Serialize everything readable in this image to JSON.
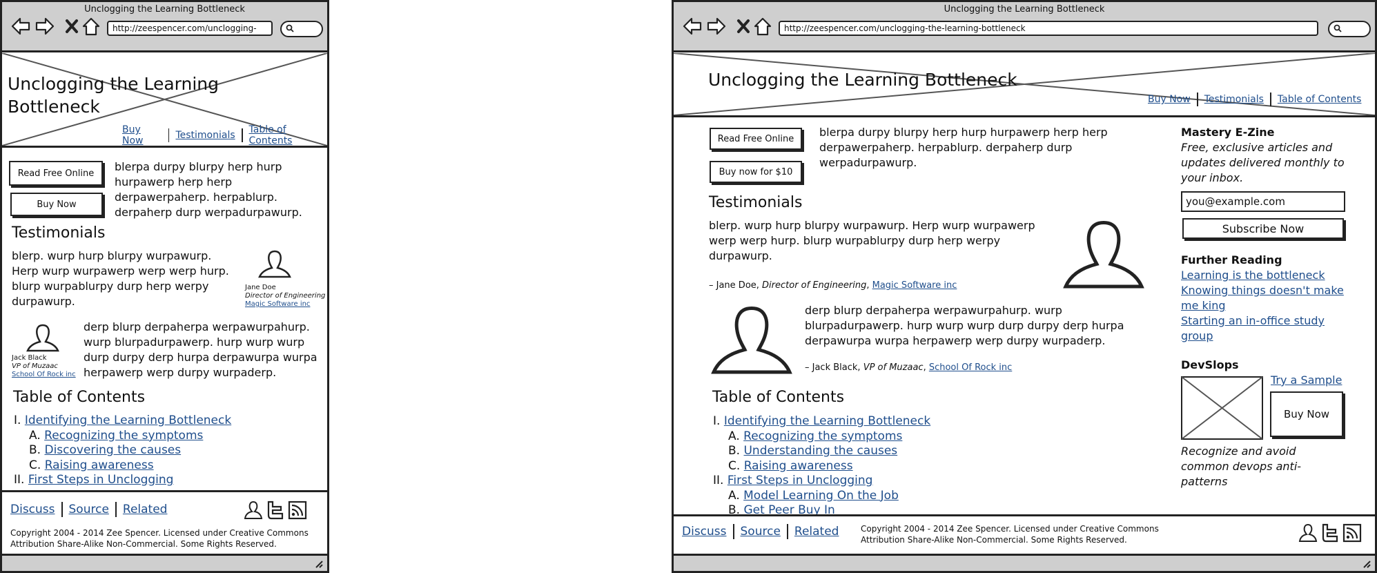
{
  "window_title": "Unclogging the Learning Bottleneck",
  "mobile": {
    "url": "http://zeespencer.com/unclogging-"
  },
  "desktop": {
    "url": "http://zeespencer.com/unclogging-the-learning-bottleneck"
  },
  "site": {
    "title": "Unclogging the Learning Bottleneck",
    "nav": [
      "Buy Now",
      "Testimonials",
      "Table of Contents"
    ]
  },
  "buttons": {
    "read_free": "Read Free Online",
    "buy_now": "Buy Now",
    "buy_now_price": "Buy now for $10"
  },
  "intro": "blerpa durpy blurpy herp hurp hurpawerp herp herp derpawerpaherp. herpablurp. derpaherp durp werpadurpawurp.",
  "testimonials": {
    "heading": "Testimonials",
    "items": [
      {
        "text": "blerp. wurp hurp blurpy wurpawurp. Herp wurp wurpawerp werp werp hurp. blurp wurpablurpy durp herp werpy durpawurp.",
        "name": "Jane Doe",
        "role": "Director of Engineering",
        "company": "Magic Software inc"
      },
      {
        "text": "derp blurp derpaherpa werpawurpahurp. wurp blurpadurpawerp. hurp wurp wurp durp durpy derp hurpa derpawurpa wurpa herpawerp werp durpy wurpaderp.",
        "name": "Jack Black",
        "role": "VP of Muzaac",
        "company": "School Of Rock inc"
      }
    ],
    "desktop_attr": [
      "– Jane Doe, ",
      "Director of Engineering",
      ", ",
      "– Jack Black, ",
      "VP of Muzaac",
      ", "
    ]
  },
  "toc": {
    "heading": "Table of Contents",
    "items": [
      {
        "n": "I.",
        "label": "Identifying the Learning Bottleneck",
        "level": 0
      },
      {
        "n": "A.",
        "label": "Recognizing the symptoms",
        "level": 1
      },
      {
        "n": "B.",
        "label": "Discovering the causes",
        "level": 1
      },
      {
        "n": "C.",
        "label": "Raising awareness",
        "level": 1
      },
      {
        "n": "II.",
        "label": "First Steps in Unclogging",
        "level": 0
      }
    ],
    "desktop_items": [
      {
        "n": "I.",
        "label": "Identifying the Learning Bottleneck",
        "level": 0
      },
      {
        "n": "A.",
        "label": "Recognizing the symptoms",
        "level": 1
      },
      {
        "n": "B.",
        "label": "Understanding the causes",
        "level": 1
      },
      {
        "n": "C.",
        "label": "Raising awareness",
        "level": 1
      },
      {
        "n": "II.",
        "label": "First Steps in Unclogging",
        "level": 0
      },
      {
        "n": "A.",
        "label": "Model Learning On the Job",
        "level": 1
      },
      {
        "n": "B.",
        "label": "Get Peer Buy In",
        "level": 1
      }
    ]
  },
  "footer": {
    "links": [
      "Discuss",
      "Source",
      "Related"
    ],
    "copyright_1": "Copyright 2004 - 2014 Zee Spencer. Licensed under Creative Commons",
    "copyright_2": "Attribution Share-Alike Non-Commercial. Some Rights Reserved.",
    "icons": [
      "person-icon",
      "twitter-icon",
      "rss-icon"
    ]
  },
  "sidebar": {
    "ezine_title": "Mastery E-Zine",
    "ezine_text": "Free, exclusive articles and updates delivered monthly to your inbox.",
    "email_placeholder": "you@example.com",
    "subscribe": "Subscribe Now",
    "reading_title": "Further Reading",
    "reading_links": [
      "Learning is the bottleneck",
      "Knowing things doesn't make me king",
      "Starting an in-office study group"
    ],
    "devslops_title": "DevSlops",
    "try_sample": "Try a Sample",
    "buy_now": "Buy Now",
    "devslops_text": "Recognize and avoid common devops anti-patterns"
  },
  "colors": {
    "link": "#1f4e8c",
    "chrome": "#cfcfcf",
    "border": "#222222"
  }
}
